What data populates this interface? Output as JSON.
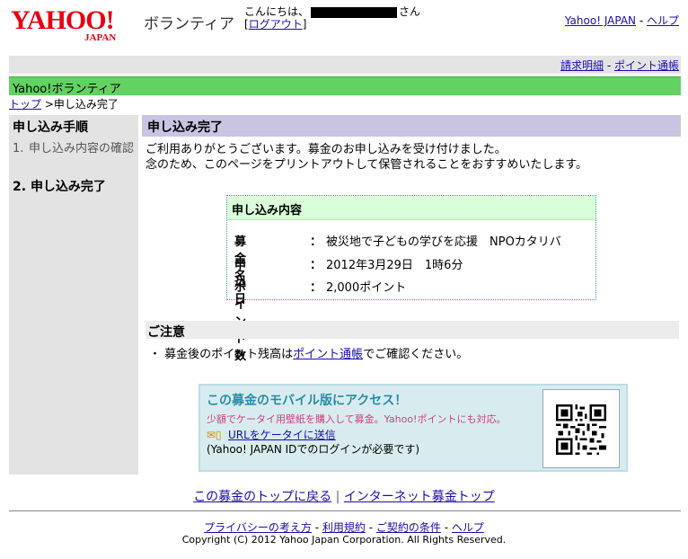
{
  "header": {
    "logo_text": "YAHOO!",
    "logo_sub": "JAPAN",
    "brand": "ボランティア",
    "greeting_prefix": "こんにちは、",
    "greeting_suffix": "さん",
    "logout_label": "ログアウト",
    "link_yahoo_japan": "Yahoo! JAPAN",
    "link_help": "ヘルプ"
  },
  "utility": {
    "billing_label": "請求明細",
    "points_label": "ポイント通帳"
  },
  "site_bar": {
    "title": "Yahoo!ボランティア"
  },
  "breadcrumb": {
    "top_label": "トップ",
    "current": "申し込み完了"
  },
  "sidebar": {
    "title": "申し込み手順",
    "steps": [
      {
        "num": "1.",
        "label": "申し込み内容の確認"
      },
      {
        "num": "2.",
        "label": "申し込み完了"
      }
    ]
  },
  "main": {
    "title": "申し込み完了",
    "thanks_line1": "ご利用ありがとうございます。募金のお申し込みを受け付けました。",
    "thanks_line2": "念のため、このページをプリントアウトして保管されることをおすすめいたします。",
    "detail": {
      "title": "申し込み内容",
      "rows": [
        {
          "label": "募金名",
          "value": "被災地で子どもの学びを応援　NPOカタリバ"
        },
        {
          "label": "申込日",
          "value": "2012年3月29日　1時6分"
        },
        {
          "label": "ポイント数",
          "value": "2,000ポイント"
        }
      ],
      "colon": "："
    },
    "notice": {
      "title": "ご注意",
      "bullet": "・",
      "text_before": "募金後のポイント残高は",
      "link": "ポイント通帳",
      "text_after": "でご確認ください。"
    }
  },
  "mobile": {
    "title": "この募金のモバイル版にアクセス！",
    "subtitle": "少額でケータイ用壁紙を購入して募金。Yahoo!ポイントにも対応。",
    "link": "URLをケータイに送信",
    "note": "(Yahoo! JAPAN IDでのログインが必要です)"
  },
  "bottom": {
    "back_top": "この募金のトップに戻る",
    "internet_top": "インターネット募金トップ"
  },
  "footer": {
    "privacy": "プライバシーの考え方",
    "terms": "利用規約",
    "contract": "ご契約の条件",
    "help": "ヘルプ",
    "copyright": "Copyright (C) 2012 Yahoo Japan Corporation. All Rights Reserved."
  },
  "colors": {
    "site_bar": "#62d262",
    "main_title_bg": "#c8c4e2",
    "detail_head_bg": "#d9ffd9",
    "mobile_bg": "#d8ecef",
    "logo_red": "#e60012",
    "link": "#1a0dab"
  }
}
